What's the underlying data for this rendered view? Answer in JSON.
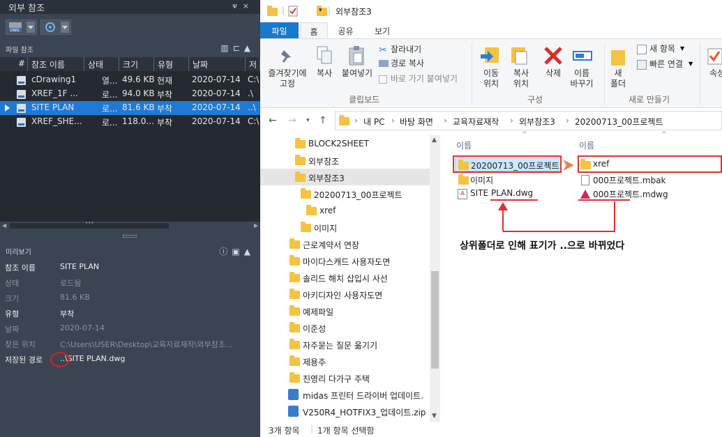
{
  "xref_palette": {
    "title": "외부 참조",
    "pin": "ᴪ",
    "close": "×",
    "file_refs_label": "파일 참조",
    "columns": [
      "#",
      "참조 이름",
      "상태",
      "크기",
      "유형",
      "날짜",
      "저"
    ],
    "rows": [
      {
        "name": "cDrawing1",
        "status": "열...",
        "size": "49.6 KB",
        "type": "현재",
        "date": "2020-07-14",
        "path": "C:\\"
      },
      {
        "name": "XREF_1F ...",
        "status": "로...",
        "size": "94.0 KB",
        "type": "부착",
        "date": "2020-07-14",
        "path": ".\\"
      },
      {
        "name": "SITE PLAN",
        "status": "로...",
        "size": "81.6 KB",
        "type": "부착",
        "date": "2020-07-14",
        "path": "..\\"
      },
      {
        "name": "XREF_SHE...",
        "status": "로...",
        "size": "118.0...",
        "type": "부착",
        "date": "2020-07-14",
        "path": "C:\\"
      }
    ],
    "scroll_dots": "•••",
    "preview_label": "미리보기",
    "details": [
      {
        "key": "참조 이름",
        "value": "SITE PLAN"
      },
      {
        "key": "상태",
        "value": "로드됨"
      },
      {
        "key": "크기",
        "value": "81.6 KB"
      },
      {
        "key": "유형",
        "value": "부착"
      },
      {
        "key": "날짜",
        "value": "2020-07-14"
      },
      {
        "key": "찾은 위치",
        "value": "C:\\Users\\USER\\Desktop\\교육자료재작\\외부참조..."
      },
      {
        "key": "저장된 경로",
        "value": "..\\SITE PLAN.dwg"
      }
    ]
  },
  "explorer": {
    "window_title": "외부참조3",
    "tabs": [
      "파일",
      "홈",
      "공유",
      "보기"
    ],
    "ribbon": {
      "pin": "즐겨찾기에\n고정",
      "copy": "복사",
      "paste": "붙여넣기",
      "cut": "잘라내기",
      "copy_path": "경로 복사",
      "paste_shortcut": "바로 가기 붙여넣기",
      "clipboard_group": "클립보드",
      "move_to": "이동\n위치",
      "copy_to": "복사\n위치",
      "delete": "삭제",
      "rename": "이름\n바꾸기",
      "organize_group": "구성",
      "new_folder": "새\n폴더",
      "new_item": "새 항목",
      "easy_access": "빠른 연결",
      "new_group": "새로 만들기",
      "properties": "속성"
    },
    "breadcrumb": [
      "내 PC",
      "바탕 화면",
      "교육자료재작",
      "외부참조3",
      "20200713_00프로젝트"
    ],
    "tree": [
      "BLOCK2SHEET",
      "외부참조",
      "외부참조3",
      "20200713_00프로젝트",
      "xref",
      "이미지",
      "근로계약서 연장",
      "마이다스캐드 사용자도면",
      "솔리드 해치 삽입시 사선",
      "아키디자인 사용자도면",
      "예제파일",
      "이준성",
      "자주묻는 질문 옮기기",
      "제용주",
      "진영리 다가구 주택",
      "midas 프린터 드라이버 업데이트.",
      "V250R4_HOTFIX3_업데이트.zip"
    ],
    "col_header_left": "이름",
    "col_header_right": "이름",
    "left_files": [
      "20200713_00프로젝트",
      "이미지",
      "SITE PLAN.dwg"
    ],
    "right_files": [
      "xref",
      "000프로젝트.mbak",
      "000프로젝트.mdwg"
    ],
    "annotation": "상위폴더로 인해 표기가 ..으로 바뀌었다",
    "status_count": "3개 항목",
    "status_selected": "1개 항목 선택함"
  }
}
